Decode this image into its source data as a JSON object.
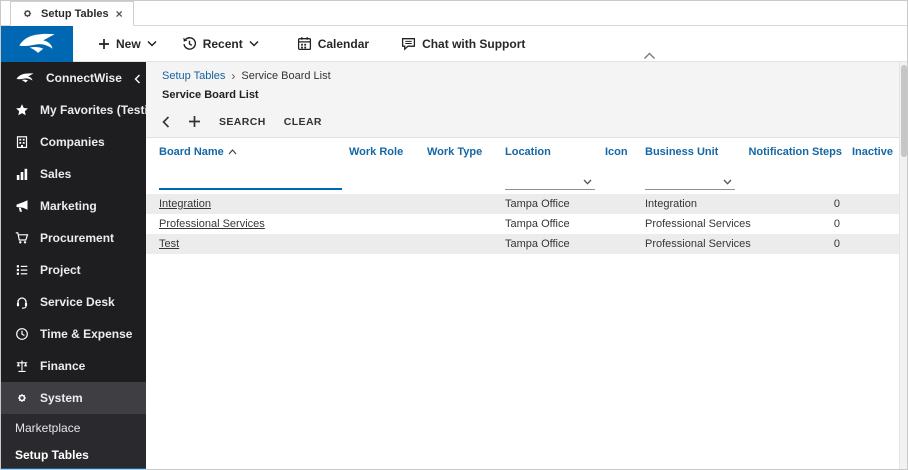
{
  "tab": {
    "title": "Setup Tables",
    "close": "×"
  },
  "topbar": {
    "new_label": "New",
    "recent_label": "Recent",
    "calendar_label": "Calendar",
    "chat_label": "Chat with Support"
  },
  "sidebar": {
    "items": [
      {
        "label": "ConnectWise"
      },
      {
        "label": "My Favorites (Testing..."
      },
      {
        "label": "Companies"
      },
      {
        "label": "Sales"
      },
      {
        "label": "Marketing"
      },
      {
        "label": "Procurement"
      },
      {
        "label": "Project"
      },
      {
        "label": "Service Desk"
      },
      {
        "label": "Time & Expense"
      },
      {
        "label": "Finance"
      },
      {
        "label": "System"
      },
      {
        "label": "Marketplace"
      },
      {
        "label": "Setup Tables"
      }
    ]
  },
  "breadcrumb": {
    "items": [
      "Setup Tables",
      "Service Board List"
    ],
    "separator": "›"
  },
  "page": {
    "title": "Service Board List"
  },
  "toolbar": {
    "search_label": "SEARCH",
    "clear_label": "CLEAR"
  },
  "filters": {
    "board_name_value": ""
  },
  "table": {
    "columns": [
      "Board Name",
      "Work Role",
      "Work Type",
      "Location",
      "Icon",
      "Business Unit",
      "Notification Steps",
      "Inactive"
    ],
    "sorted_by": "Board Name",
    "sort_direction": "ascending",
    "rows": [
      [
        "Integration",
        "",
        "",
        "Tampa Office",
        "",
        "Integration",
        "0",
        ""
      ],
      [
        "Professional Services",
        "",
        "",
        "Tampa Office",
        "",
        "Professional Services",
        "0",
        ""
      ],
      [
        "Test",
        "",
        "",
        "Tampa Office",
        "",
        "Professional Services",
        "0",
        ""
      ]
    ]
  },
  "colors": {
    "accent": "#0068b3",
    "sidebar_bg": "#1e1e21",
    "link_blue": "#1567a6",
    "row_stripe": "#ececec"
  }
}
